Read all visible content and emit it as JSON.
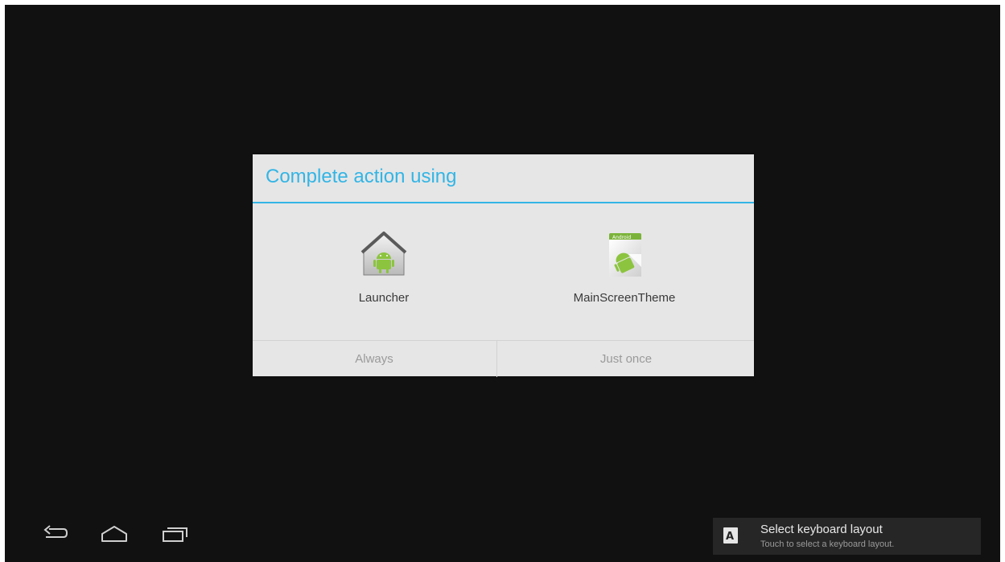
{
  "dialog": {
    "title": "Complete action using",
    "accent_color": "#33b5e5",
    "options": [
      {
        "label": "Launcher",
        "icon": "launcher-icon"
      },
      {
        "label": "MainScreenTheme",
        "icon": "android-theme-icon",
        "icon_text": "Android"
      }
    ],
    "buttons": {
      "always": "Always",
      "just_once": "Just once"
    }
  },
  "nav": {
    "back": "back-icon",
    "home": "home-icon",
    "recents": "recents-icon"
  },
  "notification": {
    "icon": "keyboard-layout-icon",
    "icon_letter": "A",
    "title": "Select keyboard layout",
    "subtitle": "Touch to select a keyboard layout."
  }
}
